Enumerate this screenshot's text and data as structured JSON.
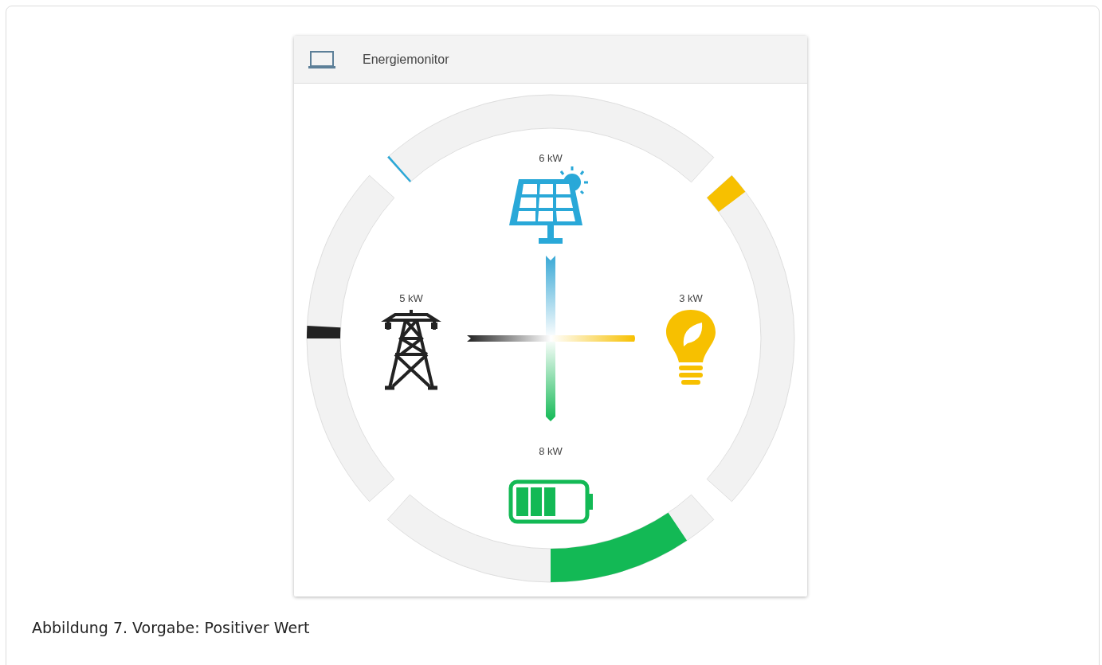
{
  "card": {
    "title": "Energiemonitor"
  },
  "gauges": [
    {
      "kind": "start",
      "color": "#29a8d8"
    },
    {
      "kind": "start",
      "color": "#f7c000"
    },
    {
      "kind": "middle_ccw",
      "color": "#13b955"
    },
    {
      "kind": "middle_cw",
      "color": "#222222"
    }
  ],
  "nodes": [
    {
      "kind": "solar",
      "label": "6 kW"
    },
    {
      "kind": "grid",
      "label": "5 kW"
    },
    {
      "kind": "consumer",
      "label": "3 kW"
    },
    {
      "kind": "battery",
      "label": "8 kW"
    }
  ],
  "caption": "Abbildung 7. Vorgabe: Positiver Wert"
}
